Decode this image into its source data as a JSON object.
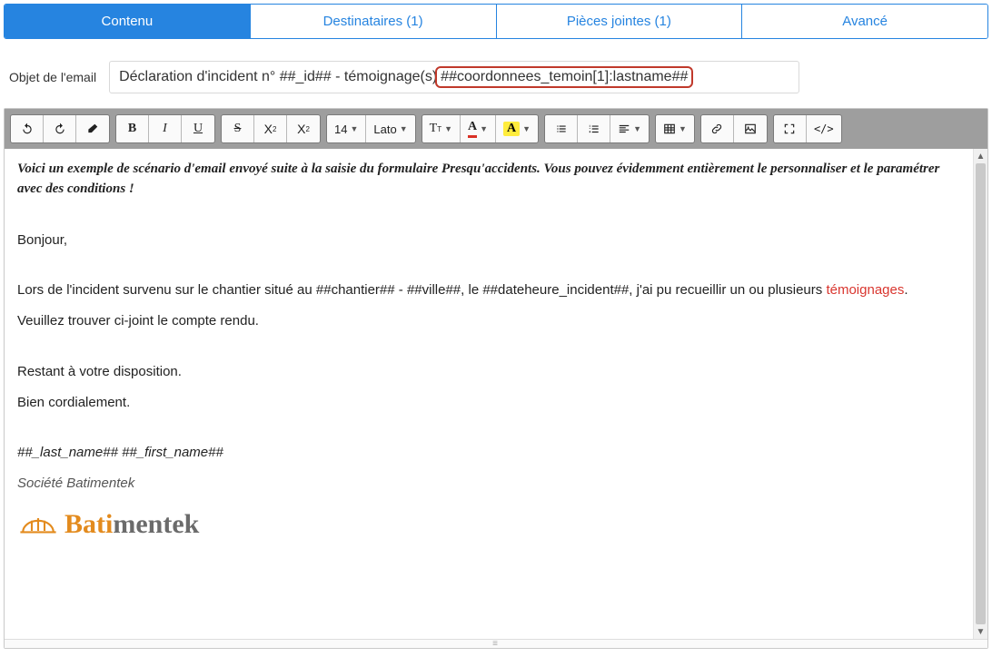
{
  "tabs": [
    {
      "label": "Contenu",
      "active": true
    },
    {
      "label": "Destinataires (1)",
      "active": false
    },
    {
      "label": "Pièces jointes (1)",
      "active": false
    },
    {
      "label": "Avancé",
      "active": false
    }
  ],
  "subject": {
    "label": "Objet de l'email",
    "value_prefix": "Déclaration d'incident  n° ##_id## - témoignage(s)",
    "value_highlight": "##coordonnees_temoin[1]:lastname##"
  },
  "toolbar": {
    "font_size": "14",
    "font_family": "Lato"
  },
  "body": {
    "intro": "Voici un exemple de scénario d'email envoyé suite à la saisie du formulaire Presqu'accidents. Vous pouvez évidemment entièrement le personnaliser et le paramétrer avec des conditions !",
    "greeting": "Bonjour,",
    "p1_a": "Lors de l'incident survenu sur le chantier situé au ##chantier## - ##ville##, le ##dateheure_incident##, j'ai pu recueillir un ou plusieurs ",
    "p1_red": "témoignages",
    "p1_b": ".",
    "p2": "Veuillez trouver ci-joint le compte rendu.",
    "p3": "Restant à votre disposition.",
    "p4": "Bien cordialement.",
    "sig_name": "##_last_name##  ##_first_name##",
    "sig_company": "Société Batimentek",
    "logo_orange": "Bati",
    "logo_grey": "mentek"
  }
}
